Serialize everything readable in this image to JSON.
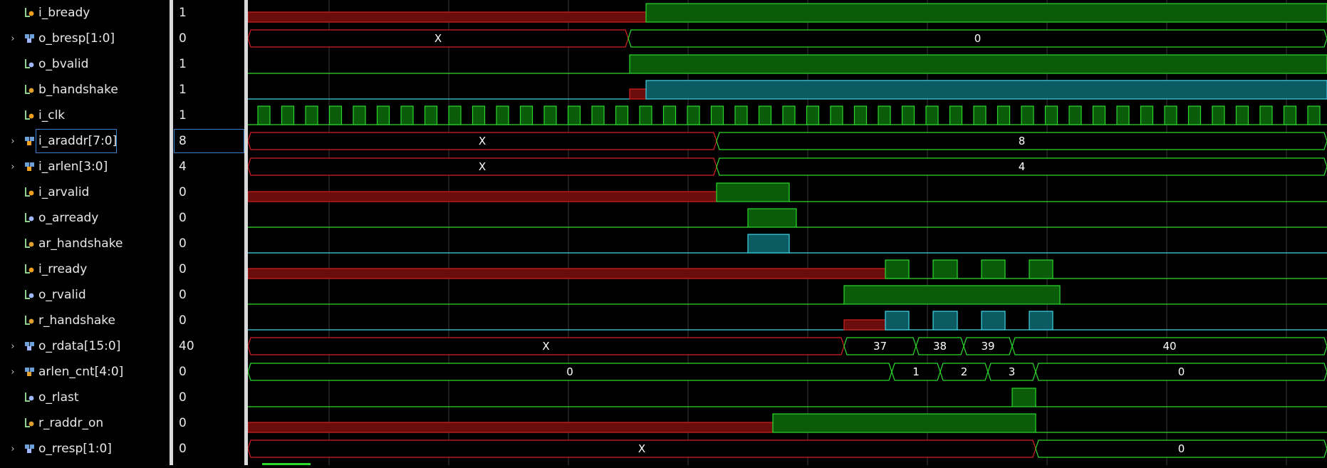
{
  "colors": {
    "high_fill": "#0a5c0a",
    "high_line": "#2bd92b",
    "x_line": "#d42020",
    "x_fill": "#6b0d0d",
    "handshake_fill": "#0c5b63",
    "handshake_line": "#3fd6e6",
    "grid": "#3a3a3a"
  },
  "signals": [
    {
      "name": "i_bready",
      "value": "1",
      "bus": false,
      "icon": "input-bit-icon"
    },
    {
      "name": "o_bresp[1:0]",
      "value": "0",
      "bus": true,
      "icon": "output-bus-icon"
    },
    {
      "name": "o_bvalid",
      "value": "1",
      "bus": false,
      "icon": "output-bit-icon"
    },
    {
      "name": "b_handshake",
      "value": "1",
      "bus": false,
      "icon": "internal-bit-icon"
    },
    {
      "name": "i_clk",
      "value": "1",
      "bus": false,
      "icon": "input-bit-icon"
    },
    {
      "name": "i_araddr[7:0]",
      "value": "8",
      "bus": true,
      "icon": "input-bus-icon",
      "selected": true
    },
    {
      "name": "i_arlen[3:0]",
      "value": "4",
      "bus": true,
      "icon": "input-bus-icon"
    },
    {
      "name": "i_arvalid",
      "value": "0",
      "bus": false,
      "icon": "input-bit-icon"
    },
    {
      "name": "o_arready",
      "value": "0",
      "bus": false,
      "icon": "output-bit-icon"
    },
    {
      "name": "ar_handshake",
      "value": "0",
      "bus": false,
      "icon": "internal-bit-icon"
    },
    {
      "name": "i_rready",
      "value": "0",
      "bus": false,
      "icon": "input-bit-icon"
    },
    {
      "name": "o_rvalid",
      "value": "0",
      "bus": false,
      "icon": "output-bit-icon"
    },
    {
      "name": "r_handshake",
      "value": "0",
      "bus": false,
      "icon": "internal-bit-icon"
    },
    {
      "name": "o_rdata[15:0]",
      "value": "40",
      "bus": true,
      "icon": "output-bus-icon"
    },
    {
      "name": "arlen_cnt[4:0]",
      "value": "0",
      "bus": true,
      "icon": "internal-bus-icon"
    },
    {
      "name": "o_rlast",
      "value": "0",
      "bus": false,
      "icon": "output-bit-icon"
    },
    {
      "name": "r_raddr_on",
      "value": "0",
      "bus": false,
      "icon": "internal-bit-icon"
    },
    {
      "name": "o_rresp[1:0]",
      "value": "0",
      "bus": true,
      "icon": "output-bus-icon"
    }
  ],
  "bus_labels": {
    "o_bresp": [
      "X",
      "0"
    ],
    "i_araddr": [
      "X",
      "8"
    ],
    "i_arlen": [
      "X",
      "4"
    ],
    "o_rdata": [
      "X",
      "37",
      "38",
      "39",
      "40"
    ],
    "arlen_cnt": [
      "0",
      "1",
      "2",
      "3",
      "0"
    ],
    "o_rresp": [
      "X",
      "0"
    ]
  }
}
